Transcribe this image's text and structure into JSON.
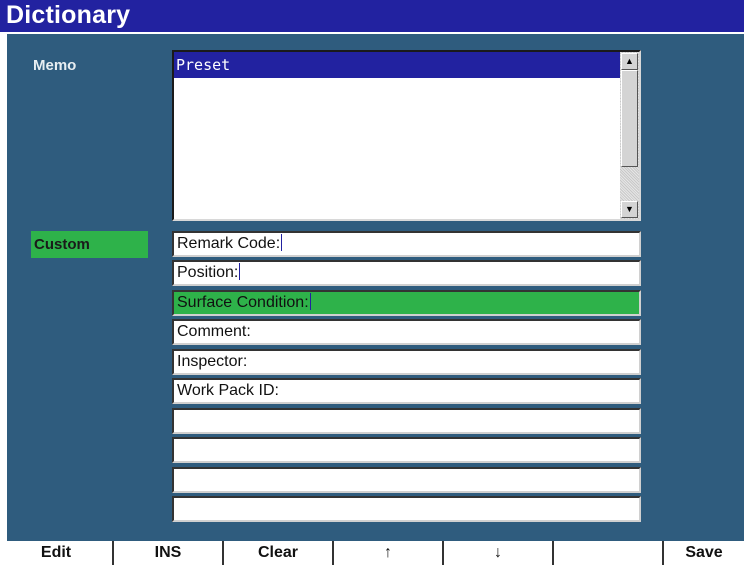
{
  "window": {
    "title": "Dictionary"
  },
  "memo": {
    "label": "Memo",
    "items": [
      "Preset"
    ],
    "scroll_up": "▲",
    "scroll_down": "▼"
  },
  "custom": {
    "label": "Custom",
    "fields": [
      "Remark Code:",
      "Position:",
      "Surface Condition:",
      "Comment:",
      "Inspector:",
      "Work Pack ID:",
      "",
      "",
      "",
      ""
    ],
    "selected_index": 2
  },
  "function_keys": [
    "Edit",
    "INS",
    "Clear",
    "↑",
    "↓",
    "",
    "Save"
  ],
  "colors": {
    "title_bg": "#2222a0",
    "panel_bg": "#2f5c7e",
    "selection_green": "#2eb24a"
  }
}
